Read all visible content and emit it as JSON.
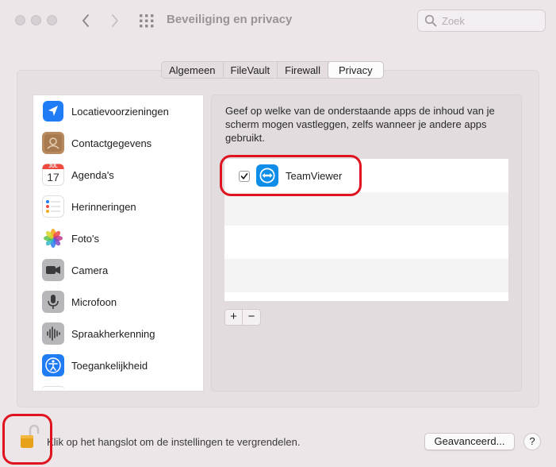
{
  "window": {
    "title": "Beveiliging en privacy"
  },
  "search": {
    "placeholder": "Zoek"
  },
  "tabs": [
    {
      "label": "Algemeen",
      "active": false
    },
    {
      "label": "FileVault",
      "active": false
    },
    {
      "label": "Firewall",
      "active": false
    },
    {
      "label": "Privacy",
      "active": true
    }
  ],
  "sidebar": {
    "items": [
      {
        "label": "Locatievoorzieningen",
        "icon": "location-arrow-icon",
        "color": "#1f7cf5"
      },
      {
        "label": "Contactgegevens",
        "icon": "contacts-icon",
        "color": "#b88a5e"
      },
      {
        "label": "Agenda's",
        "icon": "calendar-icon",
        "color": "#ffffff"
      },
      {
        "label": "Herinneringen",
        "icon": "reminders-icon",
        "color": "#ffffff"
      },
      {
        "label": "Foto's",
        "icon": "photos-icon",
        "color": "#ffffff"
      },
      {
        "label": "Camera",
        "icon": "camera-icon",
        "color": "#8e8e93"
      },
      {
        "label": "Microfoon",
        "icon": "microphone-icon",
        "color": "#8e8e93"
      },
      {
        "label": "Spraakherkenning",
        "icon": "speech-recognition-icon",
        "color": "#8e8e93"
      },
      {
        "label": "Toegankelijkheid",
        "icon": "accessibility-icon",
        "color": "#1f7cf5"
      }
    ],
    "calendar_month": "JUL",
    "calendar_day": "17"
  },
  "privacy": {
    "description": "Geef op welke van de onderstaande apps de inhoud van je scherm mogen vastleggen, zelfs wanneer je andere apps gebruikt.",
    "apps": [
      {
        "name": "TeamViewer",
        "checked": true,
        "icon": "teamviewer-icon"
      }
    ],
    "add_label": "+",
    "remove_label": "−"
  },
  "footer": {
    "lock_text": "Klik op het hangslot om de instellingen te vergrendelen.",
    "advanced_label": "Geavanceerd...",
    "help_label": "?"
  },
  "colors": {
    "highlight": "#e0141f",
    "accent": "#1f7cf5",
    "lock": "#e8a21a"
  }
}
